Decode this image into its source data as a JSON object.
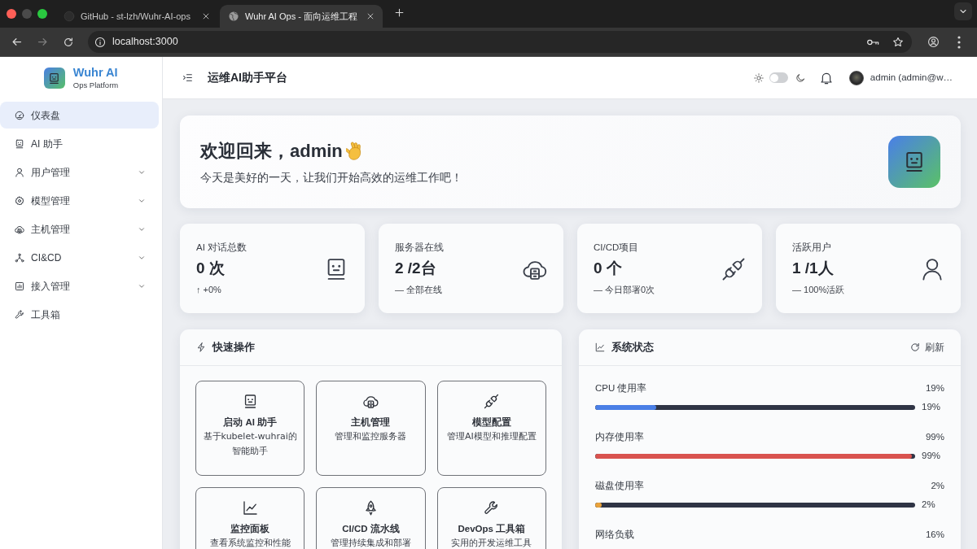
{
  "browser": {
    "tabs": [
      {
        "title": "GitHub - st-lzh/Wuhr-AI-ops",
        "selected": false
      },
      {
        "title": "Wuhr AI Ops - 面向运维工程",
        "selected": true
      }
    ],
    "forward_disabled": true,
    "address": "localhost:3000"
  },
  "sidebar": {
    "brand": "Wuhr AI",
    "tagline": "Ops Platform",
    "items": [
      {
        "label": "仪表盘",
        "kind": "link",
        "selected": true
      },
      {
        "label": "AI 助手",
        "kind": "link",
        "selected": false
      },
      {
        "label": "用户管理",
        "kind": "group",
        "selected": false,
        "expanded": false
      },
      {
        "label": "模型管理",
        "kind": "group",
        "selected": false,
        "expanded": false
      },
      {
        "label": "主机管理",
        "kind": "group",
        "selected": false,
        "expanded": false
      },
      {
        "label": "CI&CD",
        "kind": "group",
        "selected": false,
        "expanded": false
      },
      {
        "label": "接入管理",
        "kind": "group",
        "selected": false,
        "expanded": false
      },
      {
        "label": "工具箱",
        "kind": "link",
        "selected": false
      }
    ]
  },
  "header": {
    "title": "运维AI助手平台",
    "dark_mode": false,
    "user": "admin (admin@w…"
  },
  "welcome": {
    "title": "欢迎回来，admin",
    "subtitle": "今天是美好的一天，让我们开始高效的运维工作吧！"
  },
  "stats": [
    {
      "label": "AI 对话总数",
      "value": "0 次",
      "note": "↑ +0%"
    },
    {
      "label": "服务器在线",
      "value": "2 /2台",
      "note": "— 全部在线"
    },
    {
      "label": "CI/CD项目",
      "value": "0 个",
      "note": "— 今日部署0次"
    },
    {
      "label": "活跃用户",
      "value": "1 /1人",
      "note": "— 100%活跃"
    }
  ],
  "quick_actions": {
    "title": "快速操作",
    "items": [
      {
        "title": "启动 AI 助手",
        "description": "基于kubelet-wuhrai的智能助手"
      },
      {
        "title": "主机管理",
        "description": "管理和监控服务器"
      },
      {
        "title": "模型配置",
        "description": "管理AI模型和推理配置"
      },
      {
        "title": "监控面板",
        "description": "查看系统监控和性能"
      },
      {
        "title": "CI/CD 流水线",
        "description": "管理持续集成和部署"
      },
      {
        "title": "DevOps 工具箱",
        "description": "实用的开发运维工具"
      }
    ]
  },
  "system_status": {
    "title": "系统状态",
    "refresh": "刷新",
    "metrics": [
      {
        "label": "CPU 使用率",
        "value": "19%",
        "level": 0.19,
        "color": "#4a7fe6",
        "reading": "19%"
      },
      {
        "label": "内存使用率",
        "value": "99%",
        "level": 0.99,
        "color": "#d9534f",
        "reading": "99%"
      },
      {
        "label": "磁盘使用率",
        "value": "2%",
        "level": 0.02,
        "color": "#e9a23b",
        "reading": "2%"
      },
      {
        "label": "网络负载",
        "value": "16%"
      }
    ]
  }
}
